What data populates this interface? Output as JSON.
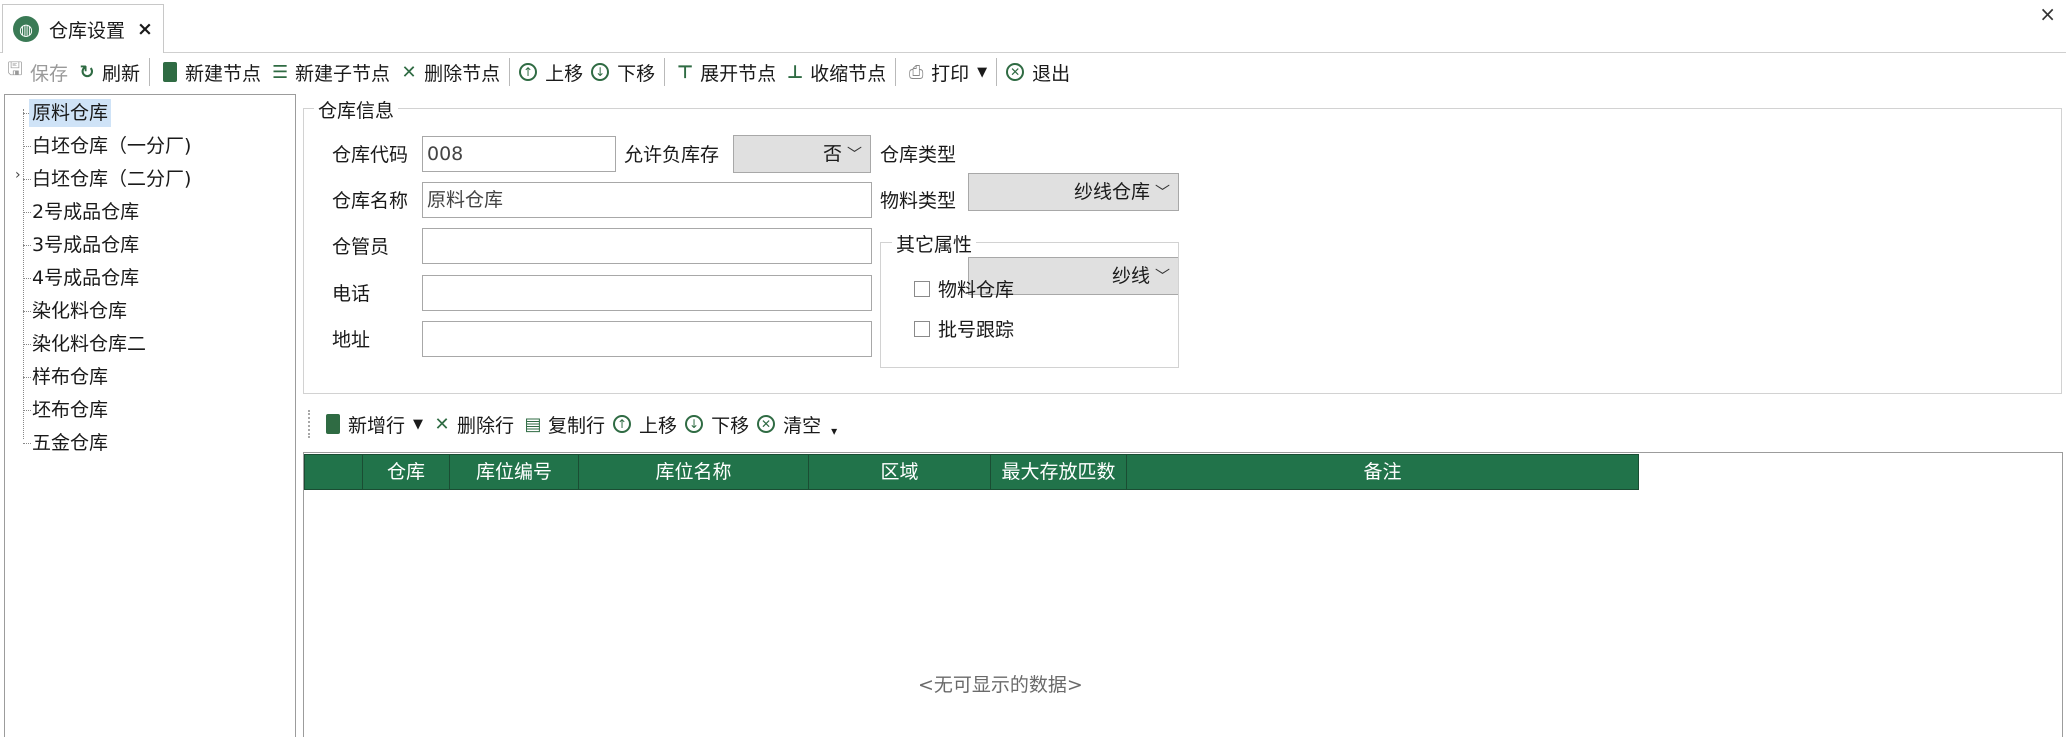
{
  "tab": {
    "title": "仓库设置",
    "close": "×"
  },
  "window": {
    "close": "×"
  },
  "toolbar": {
    "save": "保存",
    "refresh": "刷新",
    "new_node": "新建节点",
    "new_child": "新建子节点",
    "delete_node": "删除节点",
    "move_up": "上移",
    "move_down": "下移",
    "expand": "展开节点",
    "collapse": "收缩节点",
    "print": "打印",
    "exit": "退出"
  },
  "tree": {
    "items": [
      {
        "label": "原料仓库",
        "selected": true
      },
      {
        "label": "白坯仓库（一分厂)"
      },
      {
        "label": "白坯仓库（二分厂)",
        "expandable": true
      },
      {
        "label": "2号成品仓库"
      },
      {
        "label": "3号成品仓库"
      },
      {
        "label": "4号成品仓库"
      },
      {
        "label": "染化料仓库"
      },
      {
        "label": "染化料仓库二"
      },
      {
        "label": "样布仓库"
      },
      {
        "label": "坯布仓库"
      },
      {
        "label": "五金仓库"
      }
    ]
  },
  "info": {
    "legend": "仓库信息",
    "code_label": "仓库代码",
    "code_value": "008",
    "negative_label": "允许负库存",
    "negative_value": "否",
    "type_label": "仓库类型",
    "type_value": "纱线仓库",
    "name_label": "仓库名称",
    "name_value": "原料仓库",
    "material_label": "物料类型",
    "material_value": "纱线",
    "keeper_label": "仓管员",
    "keeper_value": "",
    "phone_label": "电话",
    "phone_value": "",
    "address_label": "地址",
    "address_value": "",
    "other_legend": "其它属性",
    "material_warehouse": "物料仓库",
    "batch_tracking": "批号跟踪"
  },
  "grid_toolbar": {
    "add_row": "新增行",
    "delete_row": "删除行",
    "copy_row": "复制行",
    "move_up": "上移",
    "move_down": "下移",
    "clear": "清空"
  },
  "grid": {
    "columns": [
      "",
      "仓库",
      "库位编号",
      "库位名称",
      "区域",
      "最大存放匹数",
      "备注"
    ],
    "empty_text": "<无可显示的数据>",
    "header_color": "#21734a"
  }
}
